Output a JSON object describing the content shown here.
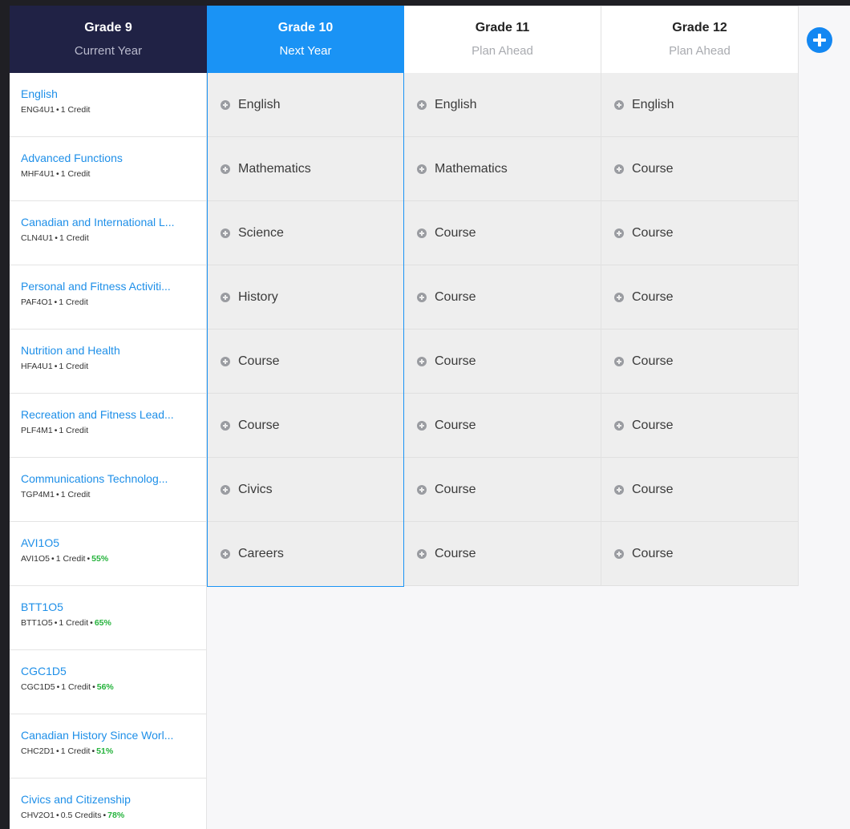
{
  "headers": [
    {
      "title": "Grade 9",
      "subtitle": "Current Year"
    },
    {
      "title": "Grade 10",
      "subtitle": "Next Year"
    },
    {
      "title": "Grade 11",
      "subtitle": "Plan Ahead"
    },
    {
      "title": "Grade 12",
      "subtitle": "Plan Ahead"
    }
  ],
  "grade9_courses": [
    {
      "name": "English",
      "code": "ENG4U1",
      "credit": "1 Credit",
      "grade": ""
    },
    {
      "name": "Advanced Functions",
      "code": "MHF4U1",
      "credit": "1 Credit",
      "grade": ""
    },
    {
      "name": "Canadian and International L...",
      "code": "CLN4U1",
      "credit": "1 Credit",
      "grade": ""
    },
    {
      "name": "Personal and Fitness Activiti...",
      "code": "PAF4O1",
      "credit": "1 Credit",
      "grade": ""
    },
    {
      "name": "Nutrition and Health",
      "code": "HFA4U1",
      "credit": "1 Credit",
      "grade": ""
    },
    {
      "name": "Recreation and Fitness Lead...",
      "code": "PLF4M1",
      "credit": "1 Credit",
      "grade": ""
    },
    {
      "name": "Communications Technolog...",
      "code": "TGP4M1",
      "credit": "1 Credit",
      "grade": ""
    },
    {
      "name": "AVI1O5",
      "code": "AVI1O5",
      "credit": "1 Credit",
      "grade": "55%"
    },
    {
      "name": "BTT1O5",
      "code": "BTT1O5",
      "credit": "1 Credit",
      "grade": "65%"
    },
    {
      "name": "CGC1D5",
      "code": "CGC1D5",
      "credit": "1 Credit",
      "grade": "56%"
    },
    {
      "name": "Canadian History Since Worl...",
      "code": "CHC2D1",
      "credit": "1 Credit",
      "grade": "51%"
    },
    {
      "name": "Civics and Citizenship",
      "code": "CHV2O1",
      "credit": "0.5 Credits",
      "grade": "78%"
    }
  ],
  "grade10_slots": [
    "English",
    "Mathematics",
    "Science",
    "History",
    "Course",
    "Course",
    "Civics",
    "Careers"
  ],
  "grade11_slots": [
    "English",
    "Mathematics",
    "Course",
    "Course",
    "Course",
    "Course",
    "Course",
    "Course"
  ],
  "grade12_slots": [
    "English",
    "Course",
    "Course",
    "Course",
    "Course",
    "Course",
    "Course",
    "Course"
  ],
  "colors": {
    "current_year": "#202245",
    "next_year": "#1a93f5",
    "link": "#1e8fe8",
    "grade_pct": "#25b33c"
  },
  "icons": {
    "add_year": "plus-circle-icon",
    "add_slot": "plus-circle-small-icon"
  }
}
